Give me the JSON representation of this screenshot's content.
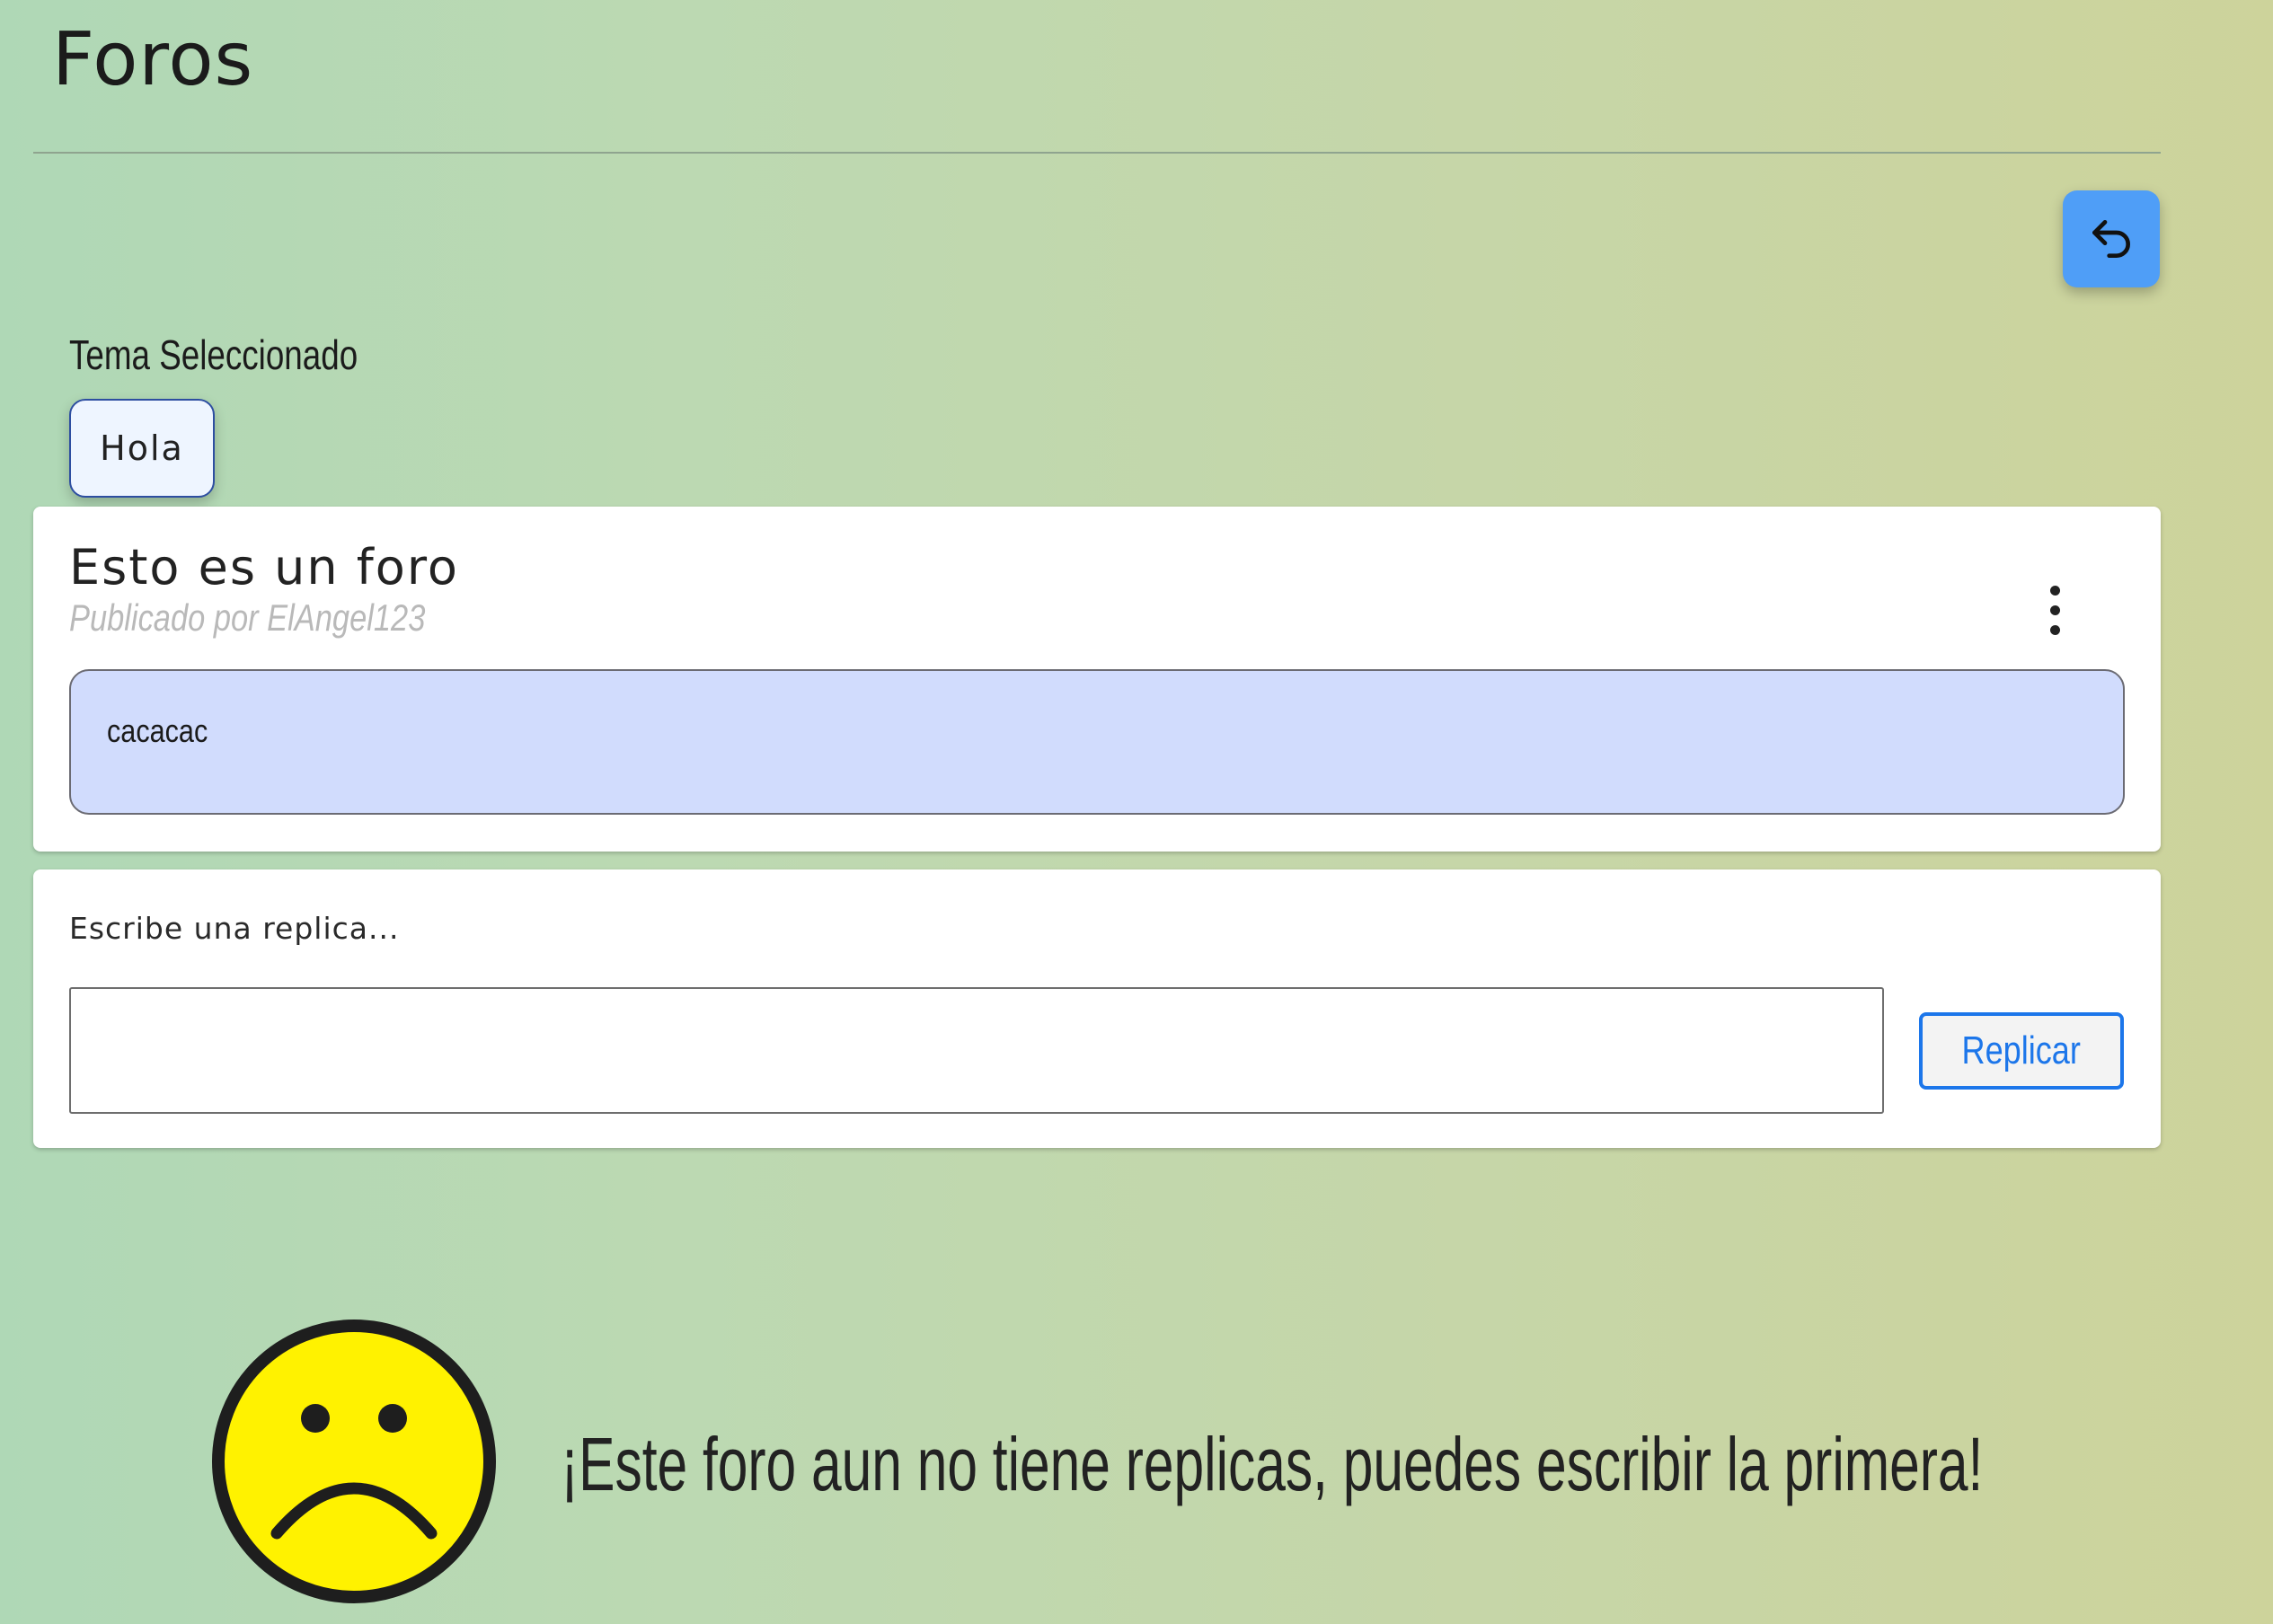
{
  "page": {
    "title": "Foros"
  },
  "toolbar": {
    "back_icon": "undo-arrow-icon",
    "back_button_color": "#4f9ef7"
  },
  "topic": {
    "label": "Tema Seleccionado",
    "selected": "Hola"
  },
  "forum": {
    "title": "Esto es un foro",
    "author_line": "Publicado por ElAngel123",
    "body": "cacacac",
    "menu_icon": "more-vertical-icon",
    "body_background": "#d1dcfd"
  },
  "reply": {
    "label": "Escribe una replica...",
    "input_value": "",
    "button_label": "Replicar",
    "button_color": "#1c76ea"
  },
  "empty_state": {
    "icon": "sad-face-icon",
    "message": "¡Este foro aun no tiene replicas, puedes escribir la primera!"
  }
}
